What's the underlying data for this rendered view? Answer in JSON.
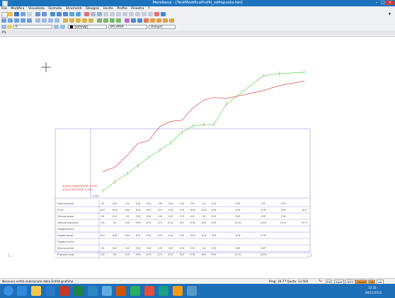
{
  "window": {
    "title": "Meridiana - [TestModificaProfili_sofioposta.fwt]"
  },
  "menu": [
    "File",
    "Modifica",
    "Visualizza",
    "Formato",
    "Strumenti",
    "Disegna",
    "Uscite",
    "Profilo",
    "Finestra",
    "?"
  ],
  "layerbar": {
    "layer": "0",
    "color_label": "DAPIANO",
    "linetype": "BYLAYER",
    "lineweight": "Dalayer"
  },
  "tab": {
    "label": "P1"
  },
  "profile": {
    "scale_label": "SCALA LUNGHEZZE 1:500",
    "scale_label2": "SCALA ALTEZZE 1:100",
    "datum_label": "15.00",
    "rows": [
      {
        "label": "Distanze parziali",
        "values": [
          "3.61",
          "15.81",
          "5.52",
          "13.82",
          "13.95",
          "9.49",
          "13.87",
          "11.91",
          "8.93",
          "2.52",
          "22.02",
          "28.81",
          "19.87",
          "27.66"
        ]
      },
      {
        "label": "Quote",
        "values": [
          "26.37",
          "26.98",
          "28.63",
          "30.25",
          "30.62",
          "32.57",
          "33.26",
          "33.41",
          "35.06",
          "36.18",
          "36.54",
          "36.39",
          "37.48",
          "38.18",
          "38.79"
        ]
      },
      {
        "label": "Distanze parziali",
        "values": [
          "3.61",
          "15.81",
          "5.52",
          "13.82",
          "13.95",
          "9.49",
          "13.87",
          "11.91",
          "8.93",
          "2.52",
          "22.02",
          "28.81",
          "19.87",
          "27.66"
        ]
      },
      {
        "label": "Distanze progressive",
        "values": [
          "0.00",
          "3.61",
          "19.42",
          "24.94",
          "38.76",
          "52.71",
          "62.20",
          "76.07",
          "87.98",
          "96.91",
          "99.43",
          "121.45",
          "150.26",
          "170.13",
          "197.79"
        ]
      },
      {
        "label": "Progetto/Confine",
        "values": []
      },
      {
        "label": "Progetto attuale",
        "values": [
          "28.37",
          "26.98",
          "28.63",
          "30.25",
          "30.62",
          "32.57",
          "33.26",
          "33.41",
          "35.06",
          "36.18",
          "36.54",
          "36.39",
          "37.48"
        ]
      },
      {
        "label": "Progetto/Confine",
        "values": []
      },
      {
        "label": "Distanze parziali",
        "values": [
          "3.61",
          "15.81",
          "5.52",
          "13.82",
          "13.95",
          "9.49",
          "13.87",
          "11.91",
          "8.93",
          "2.52",
          "22.02",
          "28.81",
          "19.87"
        ]
      },
      {
        "label": "Progressive prog.",
        "values": [
          "0.00",
          "3.61",
          "19.42",
          "24.94",
          "38.76",
          "52.71",
          "62.20",
          "76.07",
          "87.98",
          "96.91",
          "99.43",
          "121.45",
          "150.26"
        ]
      }
    ]
  },
  "status": {
    "message": "Nessuna entità selezionata della Entità grafiche",
    "coords": "Prog: 16.77  Quota: 33.502",
    "toggles": [
      "RR",
      "SNAP",
      "ORTO",
      "OSNAP",
      "ON",
      "LW"
    ]
  },
  "taskbar": {
    "time": "13:35",
    "date": "09/11/2015"
  },
  "colors": {
    "titlebar": "#1e73be",
    "terrain": "#59d64a",
    "project": "#e04848",
    "taskbar": "#1d6fb8",
    "frame": "#8a7fd6"
  }
}
